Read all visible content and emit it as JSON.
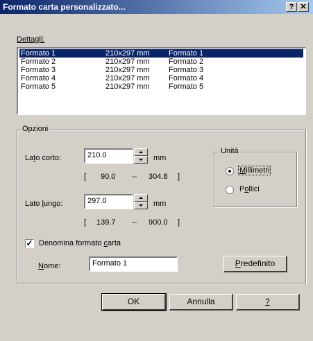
{
  "window": {
    "title": "Formato carta personalizzato...",
    "help_button": "?",
    "close_button": "✕"
  },
  "details": {
    "label": "Dettagli:",
    "rows": [
      {
        "name": "Formato 1",
        "size": "210x297 mm",
        "desc": "Formato 1",
        "selected": true
      },
      {
        "name": "Formato 2",
        "size": "210x297 mm",
        "desc": "Formato 2",
        "selected": false
      },
      {
        "name": "Formato 3",
        "size": "210x297 mm",
        "desc": "Formato 3",
        "selected": false
      },
      {
        "name": "Formato 4",
        "size": "210x297 mm",
        "desc": "Formato 4",
        "selected": false
      },
      {
        "name": "Formato 5",
        "size": "210x297 mm",
        "desc": "Formato 5",
        "selected": false
      }
    ]
  },
  "options": {
    "group_label": "Opzioni",
    "short_side": {
      "label_pre": "La",
      "label_u": "t",
      "label_post": "o corto:",
      "value": "210.0",
      "unit": "mm",
      "range_open": "[",
      "range_min": "90.0",
      "range_sep": "--",
      "range_max": "304.8",
      "range_close": "]"
    },
    "long_side": {
      "label_pre": "Lato ",
      "label_u": "l",
      "label_post": "ungo:",
      "value": "297.0",
      "unit": "mm",
      "range_open": "[",
      "range_min": "139.7",
      "range_sep": "--",
      "range_max": "900.0",
      "range_close": "]"
    },
    "units": {
      "group_label": "Unità",
      "mm_label_u": "M",
      "mm_label_rest": "illimetri",
      "mm_selected": true,
      "inch_label_pre": "P",
      "inch_label_u": "o",
      "inch_label_rest": "llici",
      "inch_selected": false
    },
    "name_format": {
      "checkbox_label_pre": "Denomina formato ",
      "checkbox_label_u": "c",
      "checkbox_label_post": "arta",
      "checked": true,
      "check_mark": "✓"
    },
    "name": {
      "label_u": "N",
      "label_rest": "ome:",
      "value": "Formato 1"
    },
    "default_button": {
      "label_u": "P",
      "label_rest": "redefinito"
    }
  },
  "buttons": {
    "ok": "OK",
    "cancel": "Annulla",
    "help": "?"
  }
}
